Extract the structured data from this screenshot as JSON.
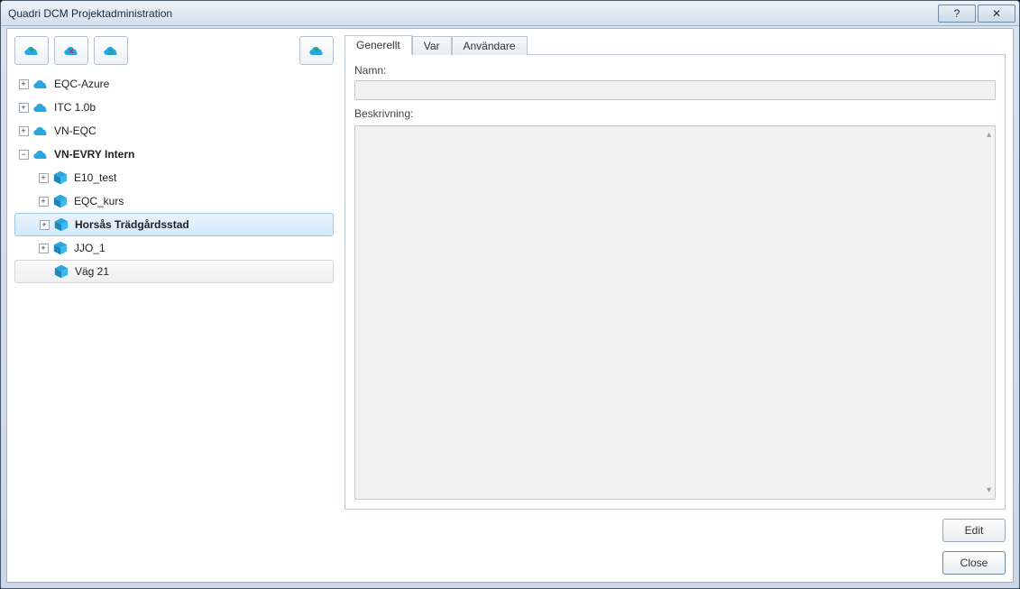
{
  "window": {
    "title": "Quadri DCM Projektadministration"
  },
  "titlebar": {
    "help": "?",
    "close": "✕"
  },
  "toolbar": {
    "add_server_tip": "Add server",
    "remove_server_tip": "Remove server",
    "refresh_tip": "Refresh",
    "new_project_tip": "New project"
  },
  "tree": {
    "servers": [
      {
        "id": "eqc-azure",
        "label": "EQC-Azure",
        "expanded": false,
        "children": []
      },
      {
        "id": "itc",
        "label": "ITC 1.0b",
        "expanded": false,
        "children": []
      },
      {
        "id": "vn-eqc",
        "label": "VN-EQC",
        "expanded": false,
        "children": []
      },
      {
        "id": "vn-evry",
        "label": "VN-EVRY Intern",
        "expanded": true,
        "bold": true,
        "children": [
          {
            "id": "e10",
            "label": "E10_test",
            "has_children": true
          },
          {
            "id": "eqckurs",
            "label": "EQC_kurs",
            "has_children": true
          },
          {
            "id": "horsas",
            "label": "Horsås Trädgårdsstad",
            "has_children": true,
            "selected": true
          },
          {
            "id": "jjo1",
            "label": "JJO_1",
            "has_children": true
          },
          {
            "id": "vag21",
            "label": "Väg 21",
            "has_children": false,
            "highlighted": true
          }
        ]
      }
    ]
  },
  "tabs": {
    "generelt": "Generellt",
    "var": "Var",
    "anvandare": "Användare",
    "active": "generelt"
  },
  "form": {
    "name_label": "Namn:",
    "name_value": "",
    "desc_label": "Beskrivning:",
    "desc_value": ""
  },
  "buttons": {
    "edit": "Edit",
    "close": "Close"
  }
}
